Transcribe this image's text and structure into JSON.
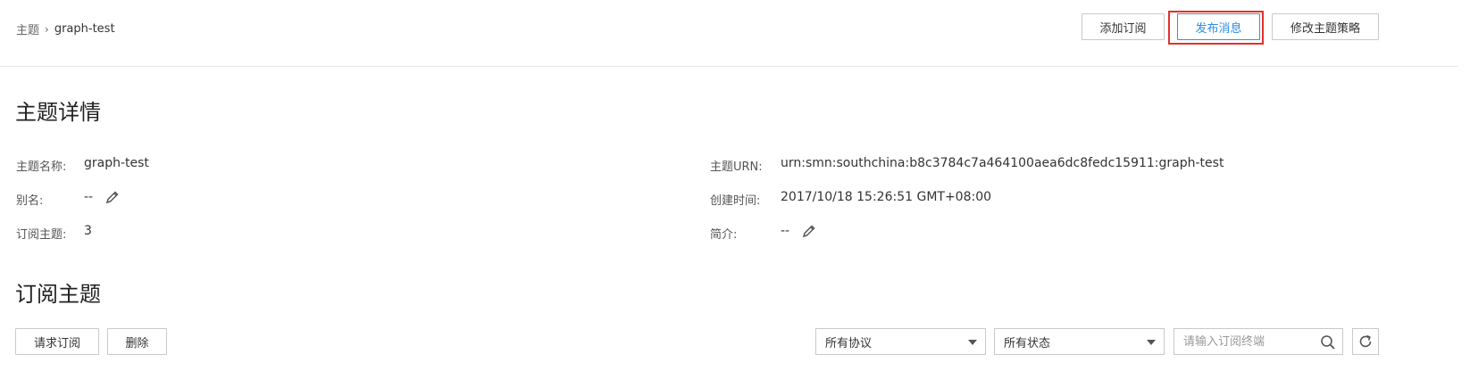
{
  "breadcrumb": {
    "root": "主题",
    "current": "graph-test"
  },
  "toolbar": {
    "add_subscription": "添加订阅",
    "publish_message": "发布消息",
    "modify_policy": "修改主题策略"
  },
  "details": {
    "title": "主题详情",
    "name_label": "主题名称:",
    "name_value": "graph-test",
    "alias_label": "别名:",
    "alias_value": "--",
    "subscriptions_label": "订阅主题:",
    "subscriptions_value": "3",
    "urn_label": "主题URN:",
    "urn_value": "urn:smn:southchina:b8c3784c7a464100aea6dc8fedc15911:graph-test",
    "created_label": "创建时间:",
    "created_value": "2017/10/18 15:26:51 GMT+08:00",
    "intro_label": "简介:",
    "intro_value": "--"
  },
  "subscriptions": {
    "title": "订阅主题",
    "request_button": "请求订阅",
    "delete_button": "删除",
    "protocol_select": "所有协议",
    "status_select": "所有状态",
    "search_placeholder": "请输入订阅终端"
  },
  "colors": {
    "accent": "#2d8ce2",
    "highlight": "#e3302c"
  }
}
